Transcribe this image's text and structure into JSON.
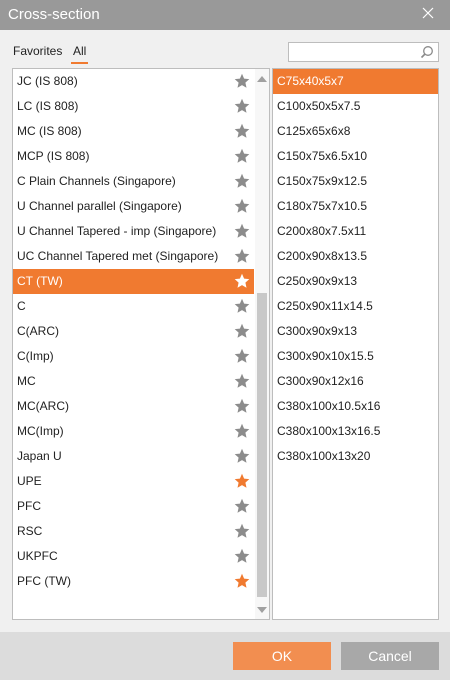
{
  "window": {
    "title": "Cross-section"
  },
  "tabs": {
    "favorites": "Favorites",
    "all": "All"
  },
  "search": {
    "value": ""
  },
  "left_list": [
    {
      "label": "JC (IS 808)",
      "favorite": false,
      "selected": false
    },
    {
      "label": "LC (IS 808)",
      "favorite": false,
      "selected": false
    },
    {
      "label": "MC (IS 808)",
      "favorite": false,
      "selected": false
    },
    {
      "label": "MCP (IS 808)",
      "favorite": false,
      "selected": false
    },
    {
      "label": "C Plain Channels (Singapore)",
      "favorite": false,
      "selected": false
    },
    {
      "label": "U Channel parallel (Singapore)",
      "favorite": false,
      "selected": false
    },
    {
      "label": "U Channel Tapered - imp (Singapore)",
      "favorite": false,
      "selected": false
    },
    {
      "label": "UC Channel Tapered met (Singapore)",
      "favorite": false,
      "selected": false
    },
    {
      "label": "CT (TW)",
      "favorite": false,
      "selected": true
    },
    {
      "label": "C",
      "favorite": false,
      "selected": false
    },
    {
      "label": "C(ARC)",
      "favorite": false,
      "selected": false
    },
    {
      "label": "C(Imp)",
      "favorite": false,
      "selected": false
    },
    {
      "label": "MC",
      "favorite": false,
      "selected": false
    },
    {
      "label": "MC(ARC)",
      "favorite": false,
      "selected": false
    },
    {
      "label": "MC(Imp)",
      "favorite": false,
      "selected": false
    },
    {
      "label": "Japan U",
      "favorite": false,
      "selected": false
    },
    {
      "label": "UPE",
      "favorite": true,
      "selected": false
    },
    {
      "label": "PFC",
      "favorite": false,
      "selected": false
    },
    {
      "label": "RSC",
      "favorite": false,
      "selected": false
    },
    {
      "label": "UKPFC",
      "favorite": false,
      "selected": false
    },
    {
      "label": "PFC (TW)",
      "favorite": true,
      "selected": false
    }
  ],
  "right_list": [
    {
      "label": "C75x40x5x7",
      "selected": true
    },
    {
      "label": "C100x50x5x7.5",
      "selected": false
    },
    {
      "label": "C125x65x6x8",
      "selected": false
    },
    {
      "label": "C150x75x6.5x10",
      "selected": false
    },
    {
      "label": "C150x75x9x12.5",
      "selected": false
    },
    {
      "label": "C180x75x7x10.5",
      "selected": false
    },
    {
      "label": "C200x80x7.5x11",
      "selected": false
    },
    {
      "label": "C200x90x8x13.5",
      "selected": false
    },
    {
      "label": "C250x90x9x13",
      "selected": false
    },
    {
      "label": "C250x90x11x14.5",
      "selected": false
    },
    {
      "label": "C300x90x9x13",
      "selected": false
    },
    {
      "label": "C300x90x10x15.5",
      "selected": false
    },
    {
      "label": "C300x90x12x16",
      "selected": false
    },
    {
      "label": "C380x100x10.5x16",
      "selected": false
    },
    {
      "label": "C380x100x13x16.5",
      "selected": false
    },
    {
      "label": "C380x100x13x20",
      "selected": false
    }
  ],
  "buttons": {
    "ok": "OK",
    "cancel": "Cancel"
  },
  "colors": {
    "accent": "#f07a30",
    "star_off": "#8c8c8c",
    "star_on": "#f07a30",
    "titlebar": "#999999"
  },
  "icons": {
    "close": "close-icon",
    "search": "search-icon",
    "star": "star-icon",
    "scroll_up": "chevron-up-icon",
    "scroll_down": "chevron-down-icon"
  }
}
